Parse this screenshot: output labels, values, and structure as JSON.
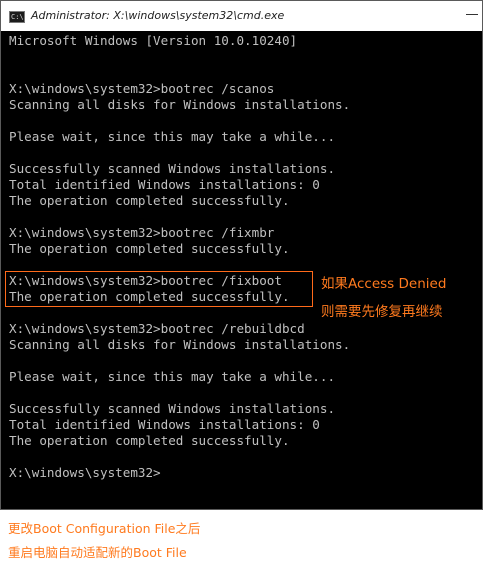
{
  "window": {
    "title": "Administrator: X:\\windows\\system32\\cmd.exe",
    "icon": "cmd-icon",
    "icon_text": "C:\\"
  },
  "console": {
    "lines": [
      "Microsoft Windows [Version 10.0.10240]",
      "",
      "",
      "X:\\windows\\system32>bootrec /scanos",
      "Scanning all disks for Windows installations.",
      "",
      "Please wait, since this may take a while...",
      "",
      "Successfully scanned Windows installations.",
      "Total identified Windows installations: 0",
      "The operation completed successfully.",
      "",
      "X:\\windows\\system32>bootrec /fixmbr",
      "The operation completed successfully.",
      "",
      "X:\\windows\\system32>bootrec /fixboot",
      "The operation completed successfully.",
      "X:\\windows\\system32>bootrec /rebuildbcd",
      "Scanning all disks for Windows installations.",
      "",
      "Please wait, since this may take a while...",
      "",
      "Successfully scanned Windows installations.",
      "Total identified Windows installations: 0",
      "The operation completed successfully.",
      "",
      "X:\\windows\\system32>"
    ]
  },
  "annotation": {
    "line1": "如果Access Denied",
    "line2": "则需要先修复再继续",
    "color": "#ff7a1e",
    "box_color": "#ff6a1a"
  },
  "caption": {
    "line1": "更改Boot Configuration File之后",
    "line2": "重启电脑自动适配新的Boot File"
  }
}
